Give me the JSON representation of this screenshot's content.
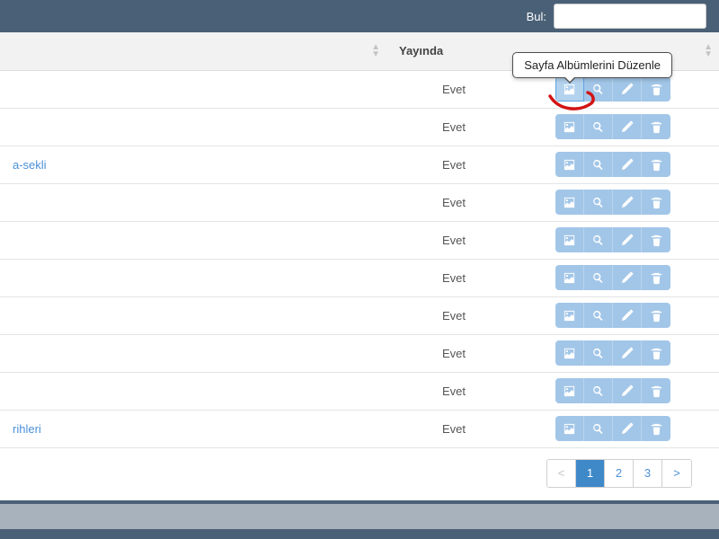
{
  "search": {
    "label": "Bul:",
    "value": ""
  },
  "columns": {
    "first": "",
    "pub": "Yayında",
    "actions": ""
  },
  "tooltip": "Sayfa Albümlerini Düzenle",
  "rows": [
    {
      "first_text": "",
      "first_link": false,
      "pub": "Evet",
      "highlight": true
    },
    {
      "first_text": "",
      "first_link": false,
      "pub": "Evet",
      "highlight": false
    },
    {
      "first_text": "a-sekli",
      "first_link": true,
      "pub": "Evet",
      "highlight": false
    },
    {
      "first_text": "",
      "first_link": false,
      "pub": "Evet",
      "highlight": false
    },
    {
      "first_text": "",
      "first_link": false,
      "pub": "Evet",
      "highlight": false
    },
    {
      "first_text": "",
      "first_link": false,
      "pub": "Evet",
      "highlight": false
    },
    {
      "first_text": "",
      "first_link": false,
      "pub": "Evet",
      "highlight": false
    },
    {
      "first_text": "",
      "first_link": false,
      "pub": "Evet",
      "highlight": false
    },
    {
      "first_text": "",
      "first_link": false,
      "pub": "Evet",
      "highlight": false
    },
    {
      "first_text": "rihleri",
      "first_link": true,
      "pub": "Evet",
      "highlight": false
    }
  ],
  "pager": {
    "prev": "<",
    "next": ">",
    "pages": [
      "1",
      "2",
      "3"
    ],
    "active": "1"
  },
  "icons": {
    "image": "image-icon",
    "search": "search-icon",
    "edit": "pencil-icon",
    "delete": "trash-icon"
  }
}
